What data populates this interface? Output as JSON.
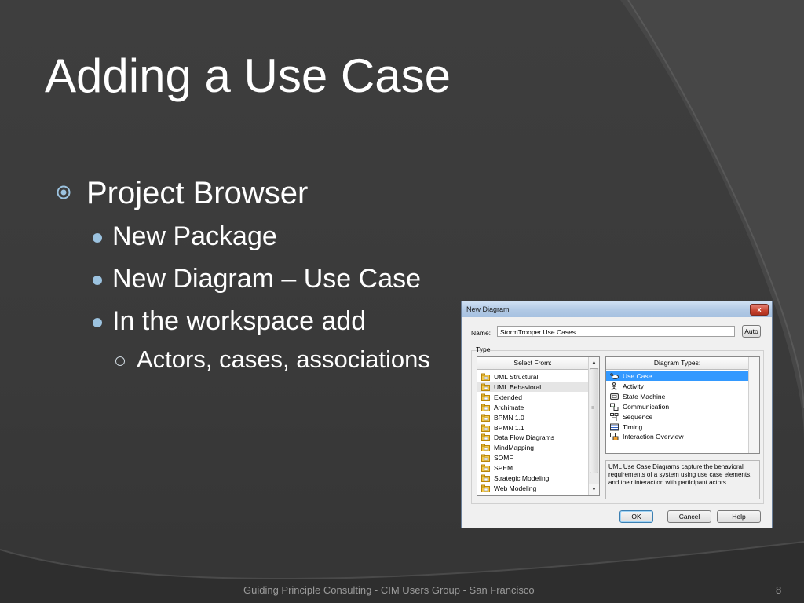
{
  "slide": {
    "title": "Adding a Use Case",
    "bullets": {
      "level1": "Project Browser",
      "level2": [
        "New Package",
        "New Diagram – Use Case",
        "In the workspace add"
      ],
      "level3": "Actors, cases, associations"
    },
    "footer": "Guiding Principle Consulting - CIM Users Group - San Francisco",
    "page_number": "8",
    "colors": {
      "background": "#3a3a3a",
      "accent_bullet": "#9cc3e0",
      "text": "#ffffff",
      "footer_text": "#9a9a9a"
    }
  },
  "dialog": {
    "title": "New Diagram",
    "close_label": "x",
    "name_label": "Name:",
    "name_value": "StormTrooper Use Cases",
    "auto_label": "Auto",
    "type_label": "Type",
    "select_from": {
      "header": "Select From:",
      "items": [
        {
          "label": "UML Structural",
          "icon": "folder-icon"
        },
        {
          "label": "UML Behavioral",
          "icon": "folder-icon",
          "state": "selected-inactive"
        },
        {
          "label": "Extended",
          "icon": "folder-icon"
        },
        {
          "label": "Archimate",
          "icon": "folder-icon"
        },
        {
          "label": "BPMN 1.0",
          "icon": "folder-icon"
        },
        {
          "label": "BPMN 1.1",
          "icon": "folder-icon"
        },
        {
          "label": "Data Flow Diagrams",
          "icon": "folder-icon"
        },
        {
          "label": "MindMapping",
          "icon": "folder-icon"
        },
        {
          "label": "SOMF",
          "icon": "folder-icon"
        },
        {
          "label": "SPEM",
          "icon": "folder-icon"
        },
        {
          "label": "Strategic Modeling",
          "icon": "folder-icon"
        },
        {
          "label": "Web Modeling",
          "icon": "folder-icon"
        }
      ]
    },
    "diagram_types": {
      "header": "Diagram Types:",
      "items": [
        {
          "label": "Use Case",
          "icon": "use-case-icon",
          "state": "selected"
        },
        {
          "label": "Activity",
          "icon": "activity-icon"
        },
        {
          "label": "State Machine",
          "icon": "state-machine-icon"
        },
        {
          "label": "Communication",
          "icon": "communication-icon"
        },
        {
          "label": "Sequence",
          "icon": "sequence-icon"
        },
        {
          "label": "Timing",
          "icon": "timing-icon"
        },
        {
          "label": "Interaction Overview",
          "icon": "interaction-overview-icon"
        }
      ]
    },
    "description": "UML Use Case Diagrams capture the behavioral requirements of a system using use case elements, and their interaction with participant actors.",
    "buttons": {
      "ok": "OK",
      "cancel": "Cancel",
      "help": "Help"
    },
    "colors": {
      "selection": "#3399ff",
      "title_bar": "#b3cbe6",
      "close_button": "#c7432f"
    }
  }
}
